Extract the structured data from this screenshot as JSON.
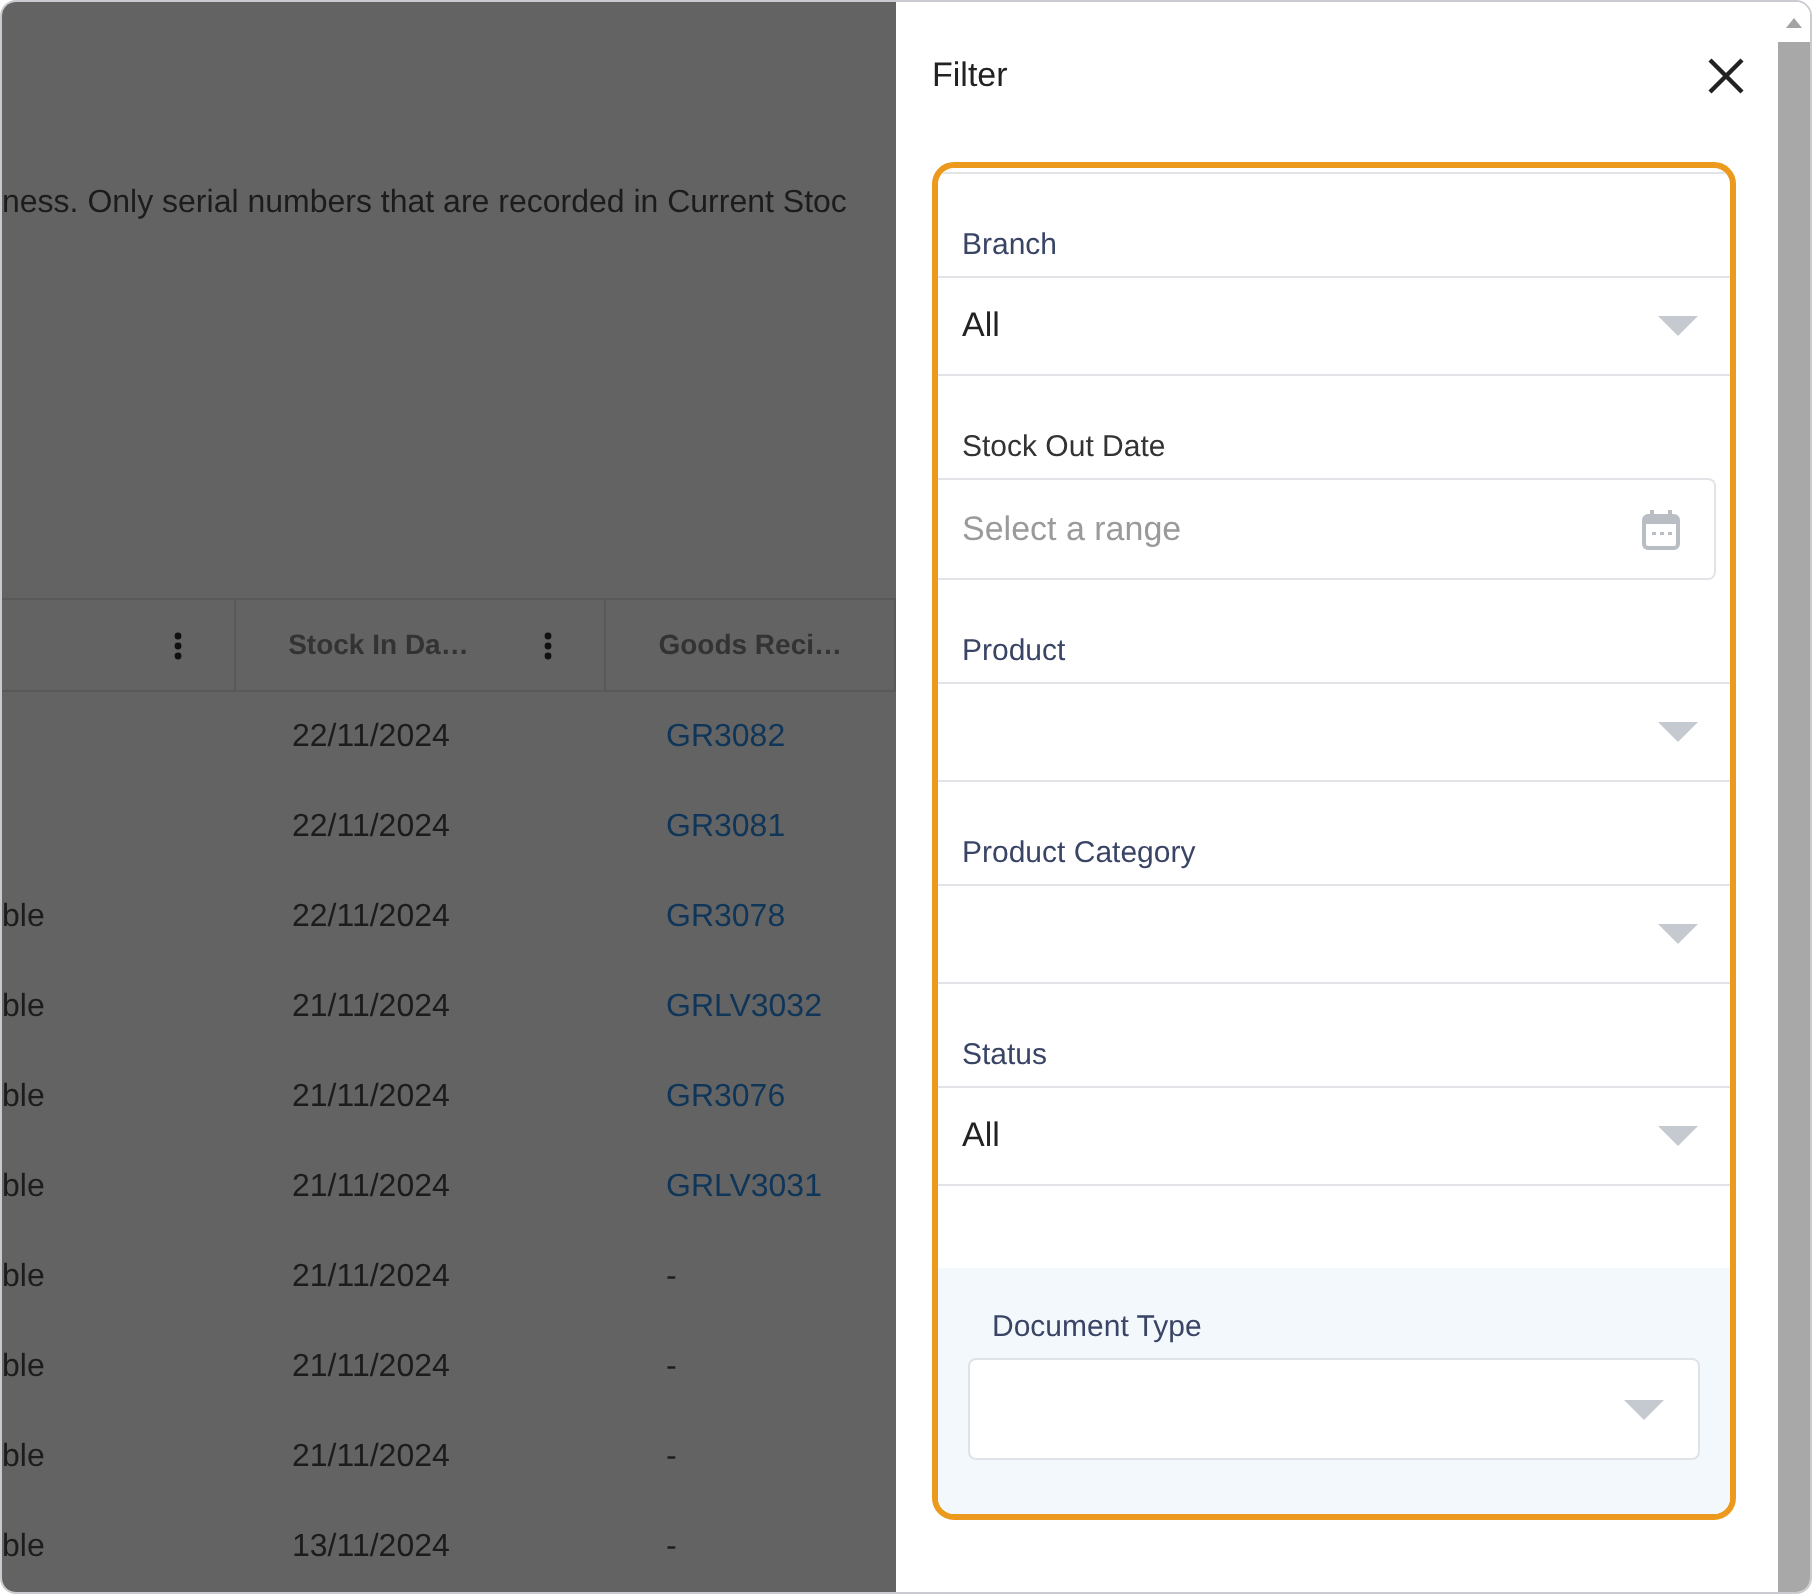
{
  "background": {
    "description": "ness. Only serial numbers that are recorded in Current Stoc",
    "table": {
      "columns": [
        {
          "menu": true
        },
        {
          "label": "Stock In Da…",
          "menu": true
        },
        {
          "label": "Goods Reci…",
          "menu": false
        }
      ],
      "rows": [
        {
          "stock_in_date": "22/11/2024",
          "goods_receipt": {
            "text": "GR3082",
            "link": true
          }
        },
        {
          "stock_in_date": "22/11/2024",
          "goods_receipt": {
            "text": "GR3081",
            "link": true
          }
        },
        {
          "column_1": "ble",
          "stock_in_date": "22/11/2024",
          "goods_receipt": {
            "text": "GR3078",
            "link": true
          }
        },
        {
          "column_1": "ble",
          "stock_in_date": "21/11/2024",
          "goods_receipt": {
            "text": "GRLV3032",
            "link": true
          }
        },
        {
          "column_1": "ble",
          "stock_in_date": "21/11/2024",
          "goods_receipt": {
            "text": "GR3076",
            "link": true
          }
        },
        {
          "column_1": "ble",
          "stock_in_date": "21/11/2024",
          "goods_receipt": {
            "text": "GRLV3031",
            "link": true
          }
        },
        {
          "column_1": "ble",
          "stock_in_date": "21/11/2024",
          "goods_receipt": {
            "text": "-",
            "link": false
          }
        },
        {
          "column_1": "ble",
          "stock_in_date": "21/11/2024",
          "goods_receipt": {
            "text": "-",
            "link": false
          }
        },
        {
          "column_1": "ble",
          "stock_in_date": "21/11/2024",
          "goods_receipt": {
            "text": "-",
            "link": false
          }
        },
        {
          "column_1": "ble",
          "stock_in_date": "13/11/2024",
          "goods_receipt": {
            "text": "-",
            "link": false
          }
        }
      ]
    }
  },
  "filter": {
    "title": "Filter",
    "fields": [
      {
        "kind": "select",
        "label": "Branch",
        "value": "All"
      },
      {
        "kind": "date_range",
        "label": "Stock Out Date",
        "placeholder": "Select a range"
      },
      {
        "kind": "select",
        "label": "Product"
      },
      {
        "kind": "select",
        "label": "Product Category"
      },
      {
        "kind": "select",
        "label": "Status",
        "value": "All"
      },
      {
        "kind": "boxed_select",
        "label": "Document Type"
      }
    ]
  }
}
